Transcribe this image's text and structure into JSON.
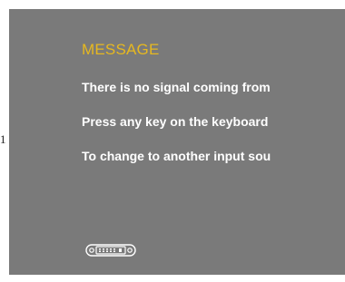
{
  "page_edge": {
    "text": "1"
  },
  "osd": {
    "title": "MESSAGE",
    "lines": [
      "There is no signal coming from",
      "Press any key on the keyboard",
      "To change to another input sou"
    ],
    "icon": "dvi-connector-icon",
    "colors": {
      "background": "#7a7a7a",
      "title": "#e6b820",
      "text": "#ffffff"
    }
  }
}
